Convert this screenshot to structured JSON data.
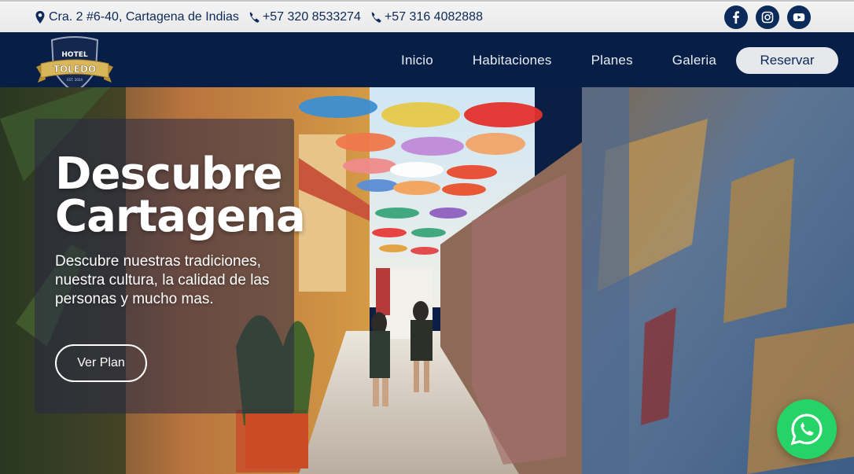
{
  "topbar": {
    "address": "Cra. 2 #6-40, Cartagena de Indias",
    "phone_1": "+57 320 8533274",
    "phone_2": "+57 316 4082888",
    "icons": [
      "map-marker-icon",
      "phone-icon",
      "phone-icon"
    ],
    "socials": [
      {
        "name": "facebook",
        "icon": "facebook-icon"
      },
      {
        "name": "instagram",
        "icon": "instagram-icon"
      },
      {
        "name": "youtube",
        "icon": "youtube-icon"
      }
    ]
  },
  "brand": {
    "logo_top": "HOTEL",
    "logo_name": "TOLEDO",
    "logo_est": "EST. 2024"
  },
  "nav": {
    "items": [
      "Inicio",
      "Habitaciones",
      "Planes",
      "Galeria"
    ],
    "cta": "Reservar"
  },
  "hero": {
    "title_line_1": "Descubre",
    "title_line_2": "Cartagena",
    "subtitle": "Descubre nuestras tradiciones, nuestra cultura, la calidad de las personas y mucho mas.",
    "button": "Ver Plan"
  },
  "floating": {
    "icon": "whatsapp-icon"
  },
  "colors": {
    "navy": "#071f47",
    "topbar": "#ededed",
    "text_dark": "#0c2a5a",
    "whatsapp": "#25d366",
    "logo_gold": "#d9b65a"
  }
}
